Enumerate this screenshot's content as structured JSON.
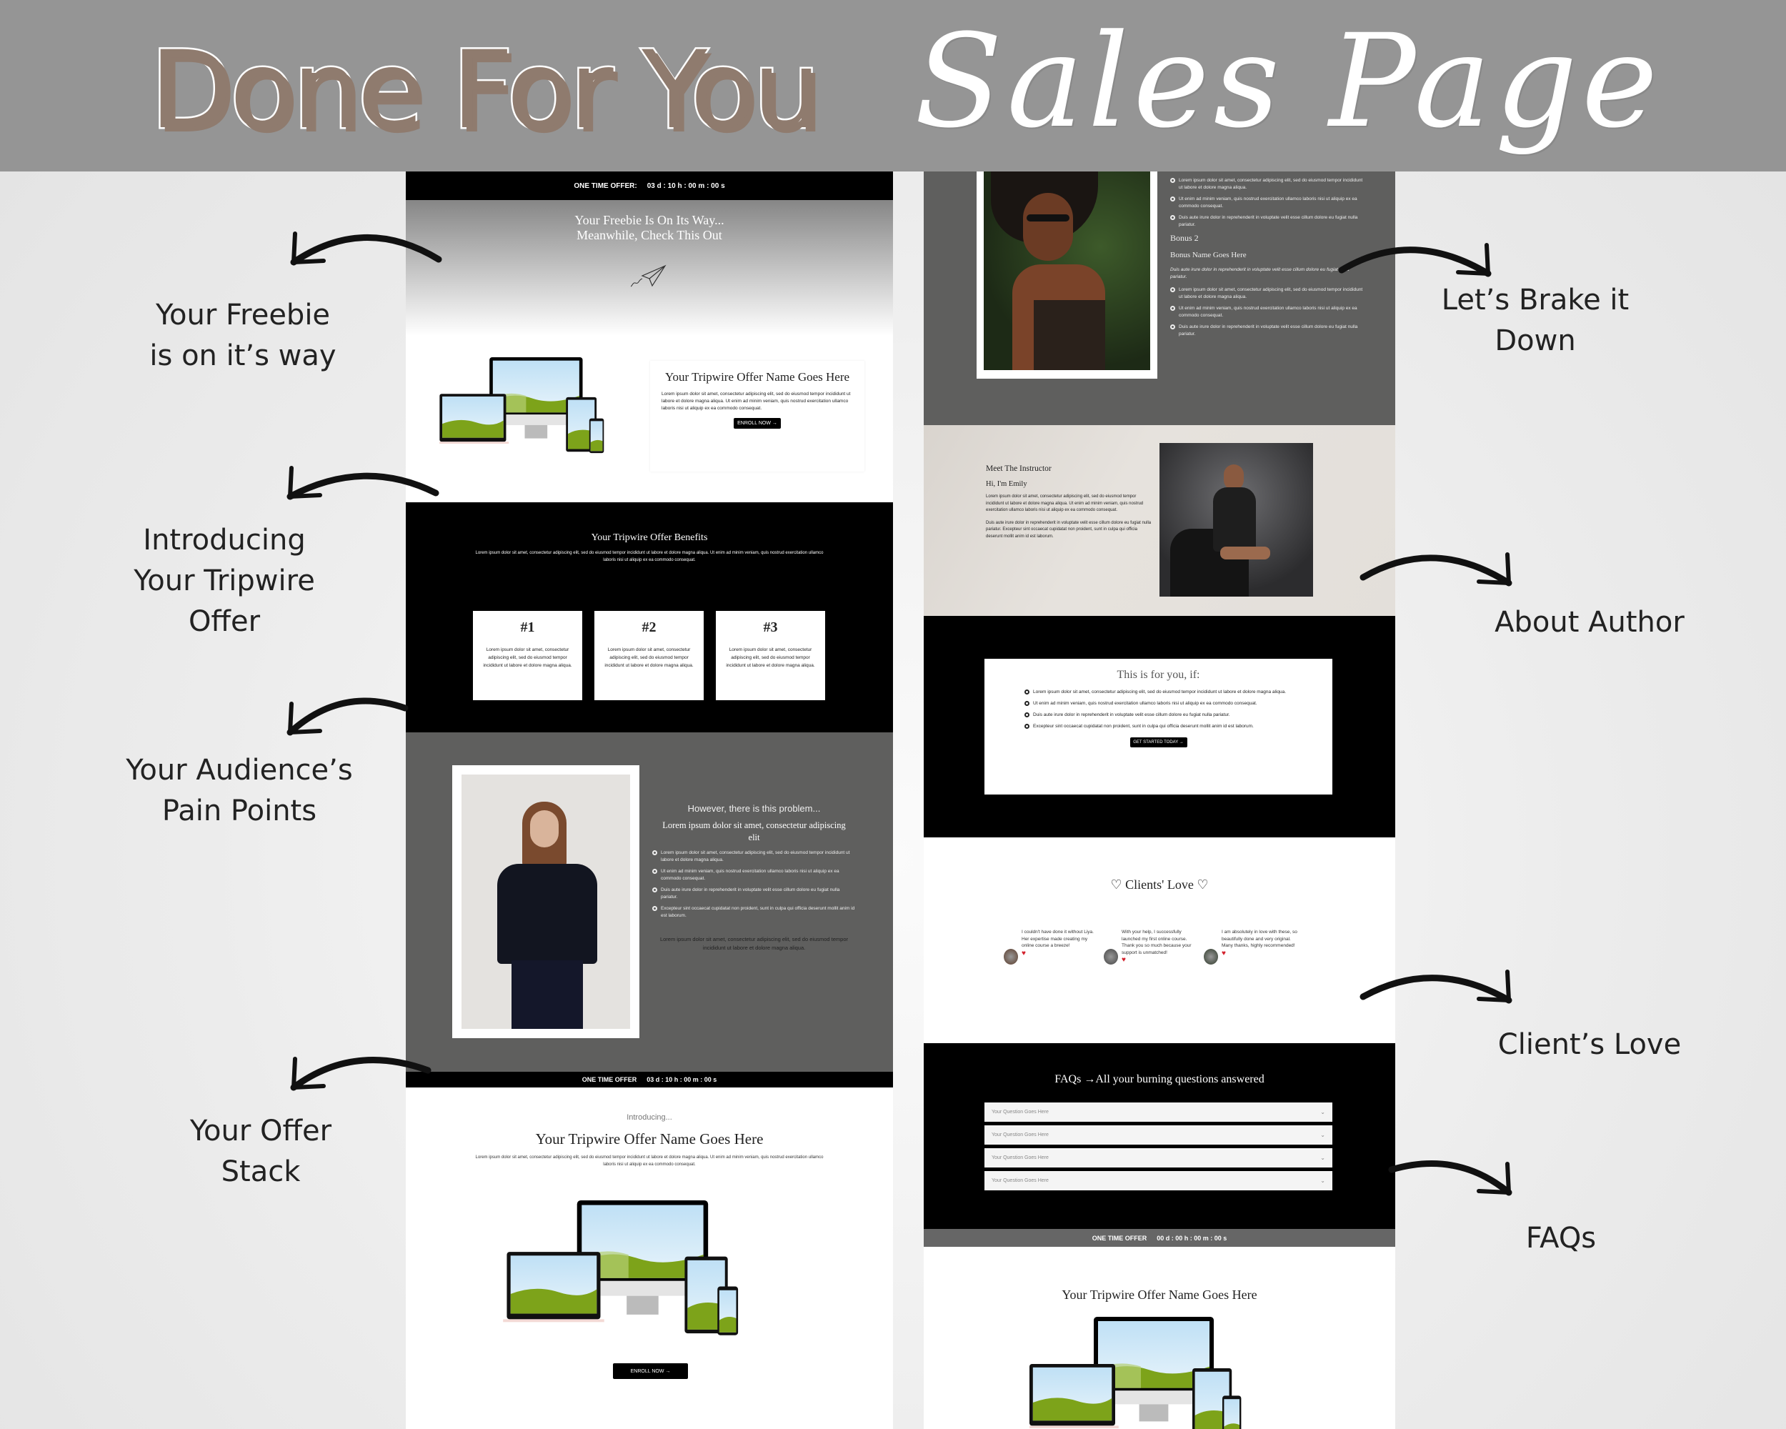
{
  "header": {
    "title_block": "Done For You",
    "title_script": "Sales Page"
  },
  "colors": {
    "header_bg": "#959595",
    "title_fill": "#8f7b6e",
    "dark_section": "#5f5f5e",
    "beige_section": "#e3dfda",
    "heart": "#d21f2b"
  },
  "annotations": {
    "freebie": [
      "Your Freebie",
      "is on it’s way"
    ],
    "tripwire": [
      "Introducing",
      "Your Tripwire",
      "Offer"
    ],
    "pain": [
      "Your Audience’s",
      "Pain Points"
    ],
    "stack": [
      "Your Offer",
      "Stack"
    ],
    "breakdown": [
      "Let’s Brake it",
      "Down"
    ],
    "author": "About Author",
    "clients": "Client’s Love",
    "faqs": "FAQs"
  },
  "left_page": {
    "timer_top": {
      "label": "ONE TIME OFFER:",
      "countdown": "03 d : 10 h : 00 m : 00 s"
    },
    "hero": {
      "line1": "Your Freebie Is On Its Way...",
      "line2": "Meanwhile, Check This Out",
      "icon": "paper-plane-icon"
    },
    "offer_card": {
      "title": "Your Tripwire Offer Name Goes Here",
      "text": "Lorem ipsum dolor sit amet, consectetur adipiscing elit, sed do eiusmod tempor incididunt ut labore et dolore magna aliqua. Ut enim ad minim veniam, quis nostrud exercitation ullamco laboris nisi ut aliquip ex ea commodo consequat.",
      "button": "ENROLL NOW →"
    },
    "benefits": {
      "title": "Your Tripwire Offer Benefits",
      "text": "Lorem ipsum dolor sit amet, consectetur adipiscing elit, sed do eiusmod tempor incididunt ut labore et dolore magna aliqua. Ut enim ad minim veniam, quis nostrud exercitation ullamco laboris nisi ut aliquip ex ea commodo consequat.",
      "cards": [
        {
          "num": "#1",
          "text": "Lorem ipsum dolor sit amet, consectetur adipiscing elit, sed do eiusmod tempor incididunt ut labore et dolore magna aliqua."
        },
        {
          "num": "#2",
          "text": "Lorem ipsum dolor sit amet, consectetur adipiscing elit, sed do eiusmod tempor incididunt ut labore et dolore magna aliqua."
        },
        {
          "num": "#3",
          "text": "Lorem ipsum dolor sit amet, consectetur adipiscing elit, sed do eiusmod tempor incididunt ut labore et dolore magna aliqua."
        }
      ]
    },
    "problem": {
      "kicker": "However, there is this problem...",
      "heading": "Lorem ipsum dolor sit amet, consectetur adipiscing elit",
      "bullets": [
        "Lorem ipsum dolor sit amet, consectetur adipiscing elit, sed do eiusmod tempor incididunt ut labore et dolore magna aliqua.",
        "Ut enim ad minim veniam, quis nostrud exercitation ullamco laboris nisi ut aliquip ex ea commodo consequat.",
        "Duis aute irure dolor in reprehenderit in voluptate velit esse cillum dolore eu fugiat nulla pariatur.",
        "Excepteur sint occaecat cupidatat non proident, sunt in culpa qui officia deserunt mollit anim id est laborum."
      ],
      "closing": "Lorem ipsum dolor sit amet, consectetur adipiscing elit, sed do eiusmod tempor incididunt ut labore et dolore magna aliqua."
    },
    "timer_mid": {
      "label": "ONE TIME OFFER",
      "countdown": "03 d : 10 h : 00 m : 00 s"
    },
    "intro": {
      "kicker": "Introducing...",
      "title": "Your Tripwire Offer Name Goes Here",
      "text": "Lorem ipsum dolor sit amet, consectetur adipiscing elit, sed do eiusmod tempor incididunt ut labore et dolore magna aliqua. Ut enim ad minim veniam, quis nostrud exercitation ullamco laboris nisi ut aliquip ex ea commodo consequat.",
      "button": "ENROLL NOW →"
    }
  },
  "right_page": {
    "bonus": {
      "bullets_top": [
        "Lorem ipsum dolor sit amet, consectetur adipiscing elit, sed do eiusmod tempor incididunt ut labore et dolore magna aliqua.",
        "Ut enim ad minim veniam, quis nostrud exercitation ullamco laboris nisi ut aliquip ex ea commodo consequat.",
        "Duis aute irure dolor in reprehenderit in voluptate velit esse cillum dolore eu fugiat nulla pariatur."
      ],
      "label": "Bonus 2",
      "name": "Bonus Name Goes Here",
      "desc": "Duis aute irure dolor in reprehenderit in voluptate velit esse cillum dolore eu fugiat nulla pariatur.",
      "bullets_bottom": [
        "Lorem ipsum dolor sit amet, consectetur adipiscing elit, sed do eiusmod tempor incididunt ut labore et dolore magna aliqua.",
        "Ut enim ad minim veniam, quis nostrud exercitation ullamco laboris nisi ut aliquip ex ea commodo consequat.",
        "Duis aute irure dolor in reprehenderit in voluptate velit esse cillum dolore eu fugiat nulla pariatur."
      ]
    },
    "instructor": {
      "title": "Meet The Instructor",
      "greeting": "Hi, I'm Emily",
      "p1": "Lorem ipsum dolor sit amet, consectetur adipiscing elit, sed do eiusmod tempor incididunt ut labore et dolore magna aliqua. Ut enim ad minim veniam, quis nostrud exercitation ullamco laboris nisi ut aliquip ex ea commodo consequat.",
      "p2": "Duis aute irure dolor in reprehenderit in voluptate velit esse cillum dolore eu fugiat nulla pariatur. Excepteur sint occaecat cupidatat non proident, sunt in culpa qui officia deserunt mollit anim id est laborum."
    },
    "for_you": {
      "title": "This is for you, if:",
      "bullets": [
        "Lorem ipsum dolor sit amet, consectetur adipiscing elit, sed do eiusmod tempor incididunt ut labore et dolore magna aliqua.",
        "Ut enim ad minim veniam, quis nostrud exercitation ullamco laboris nisi ut aliquip ex ea commodo consequat.",
        "Duis aute irure dolor in reprehenderit in voluptate velit esse cillum dolore eu fugiat nulla pariatur.",
        "Excepteur sint occaecat cupidatat non proident, sunt in culpa qui officia deserunt mollit anim id est laborum."
      ],
      "button": "GET STARTED TODAY →"
    },
    "clients": {
      "title": "♡ Clients' Love ♡",
      "testimonials": [
        "I couldn't have done it without Liya. Her expertise made creating my online course a breeze!",
        "With your help, I successfully launched my first online course. Thank you so much because your support is unmatched!",
        "I am absolutely in love with these, so beautifully done and very original. Many thanks, highly recommended!"
      ]
    },
    "faqs": {
      "title": "FAQs →All your burning questions answered",
      "questions": [
        "Your Question Goes Here",
        "Your Question Goes Here",
        "Your Question Goes Here",
        "Your Question Goes Here"
      ]
    },
    "timer_bottom": {
      "label": "ONE TIME OFFER",
      "countdown": "00 d : 00 h : 00 m : 00 s"
    },
    "final": {
      "title": "Your Tripwire Offer Name Goes Here"
    }
  }
}
